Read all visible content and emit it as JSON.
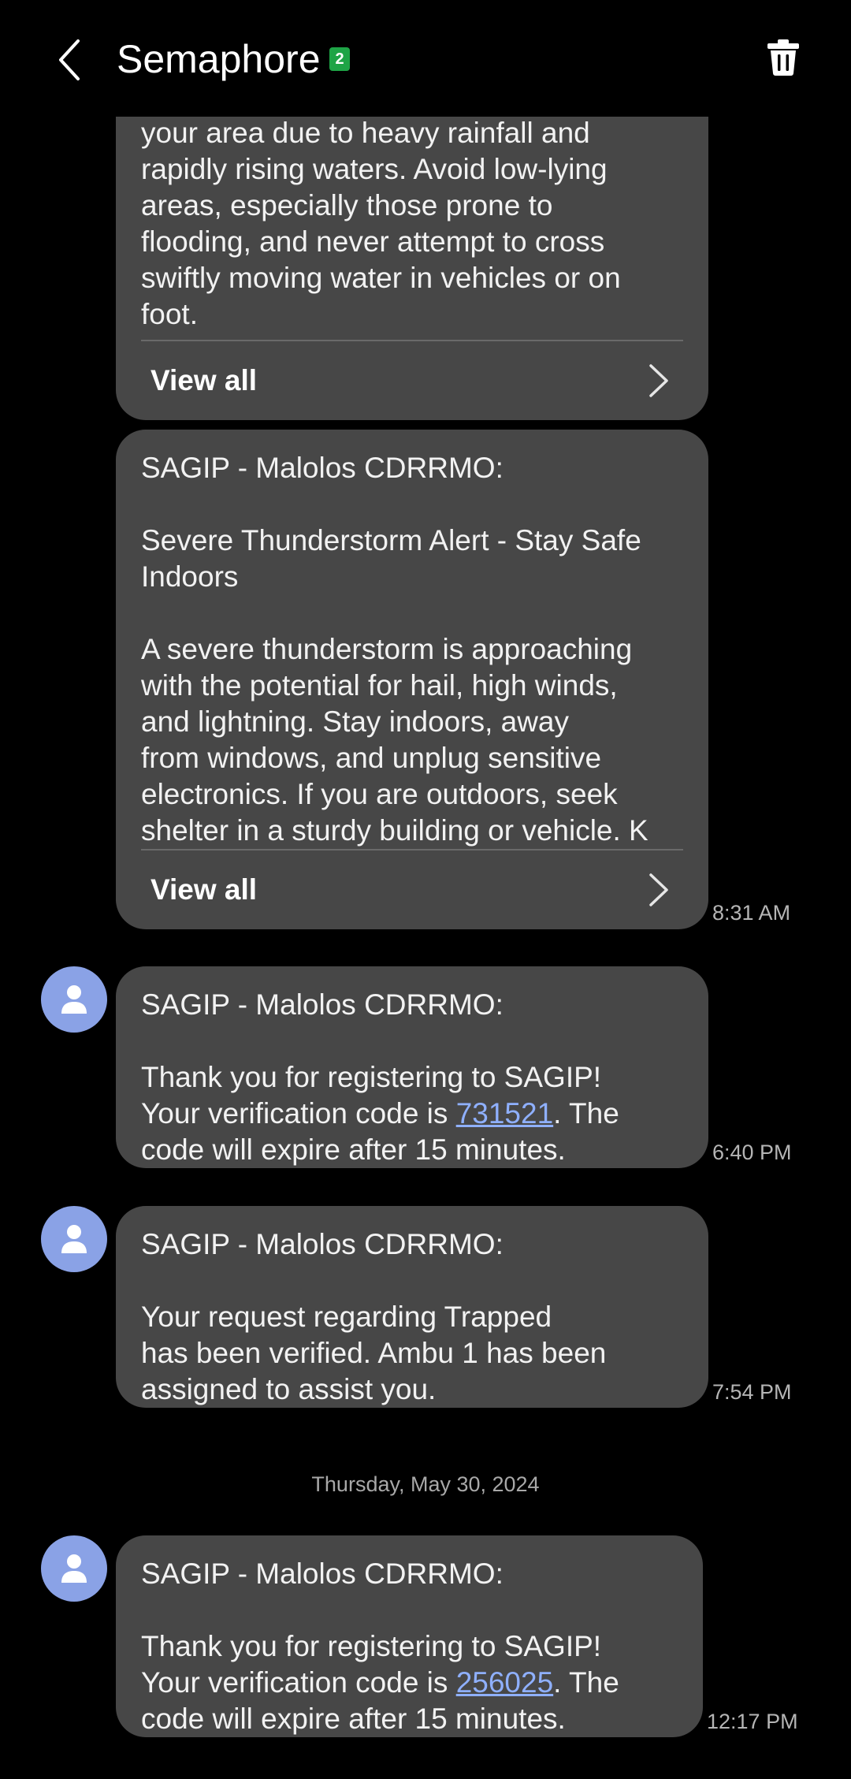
{
  "header": {
    "title": "Semaphore",
    "sim_badge": "2",
    "back_icon": "chevron-left-icon",
    "delete_icon": "trash-icon"
  },
  "messages": [
    {
      "body_lines": [
        "your area due to heavy rainfall and",
        "rapidly rising waters. Avoid low-lying",
        "areas, especially those prone to",
        "flooding, and never attempt to cross",
        "swiftly moving water in vehicles or on",
        "foot."
      ],
      "view_all": "View all"
    },
    {
      "sender": "SAGIP - Malolos CDRRMO:",
      "subject_lines": [
        "Severe Thunderstorm Alert - Stay Safe",
        "Indoors"
      ],
      "body_lines": [
        "A severe thunderstorm is approaching",
        "with the potential for hail, high winds,",
        "and lightning. Stay indoors, away",
        "from windows, and unplug sensitive",
        "electronics. If you are outdoors, seek",
        "shelter in a sturdy building or vehicle. K"
      ],
      "view_all": "View all",
      "time": "8:31 AM"
    },
    {
      "sender": "SAGIP - Malolos CDRRMO:",
      "line1": "Thank you for registering to SAGIP!",
      "code_prefix": "Your verification code is ",
      "code": "731521",
      "code_suffix": ". The",
      "line3": "code will expire after 15 minutes.",
      "time": "6:40 PM"
    },
    {
      "sender": "SAGIP - Malolos CDRRMO:",
      "body_lines": [
        "Your request regarding Trapped",
        "has been verified. Ambu 1 has been",
        "assigned to assist you."
      ],
      "time": "7:54 PM"
    },
    {
      "sender": "SAGIP - Malolos CDRRMO:",
      "line1": "Thank you for registering to SAGIP!",
      "code_prefix": "Your verification code is ",
      "code": "256025",
      "code_suffix": ". The",
      "line3": "code will expire after 15 minutes.",
      "time": "12:17 PM"
    }
  ],
  "date_separator": "Thursday, May 30, 2024",
  "colors": {
    "bubble": "#474747",
    "avatar": "#8aa2e6",
    "link": "#8fb0ff",
    "sim_badge": "#1ea446"
  }
}
